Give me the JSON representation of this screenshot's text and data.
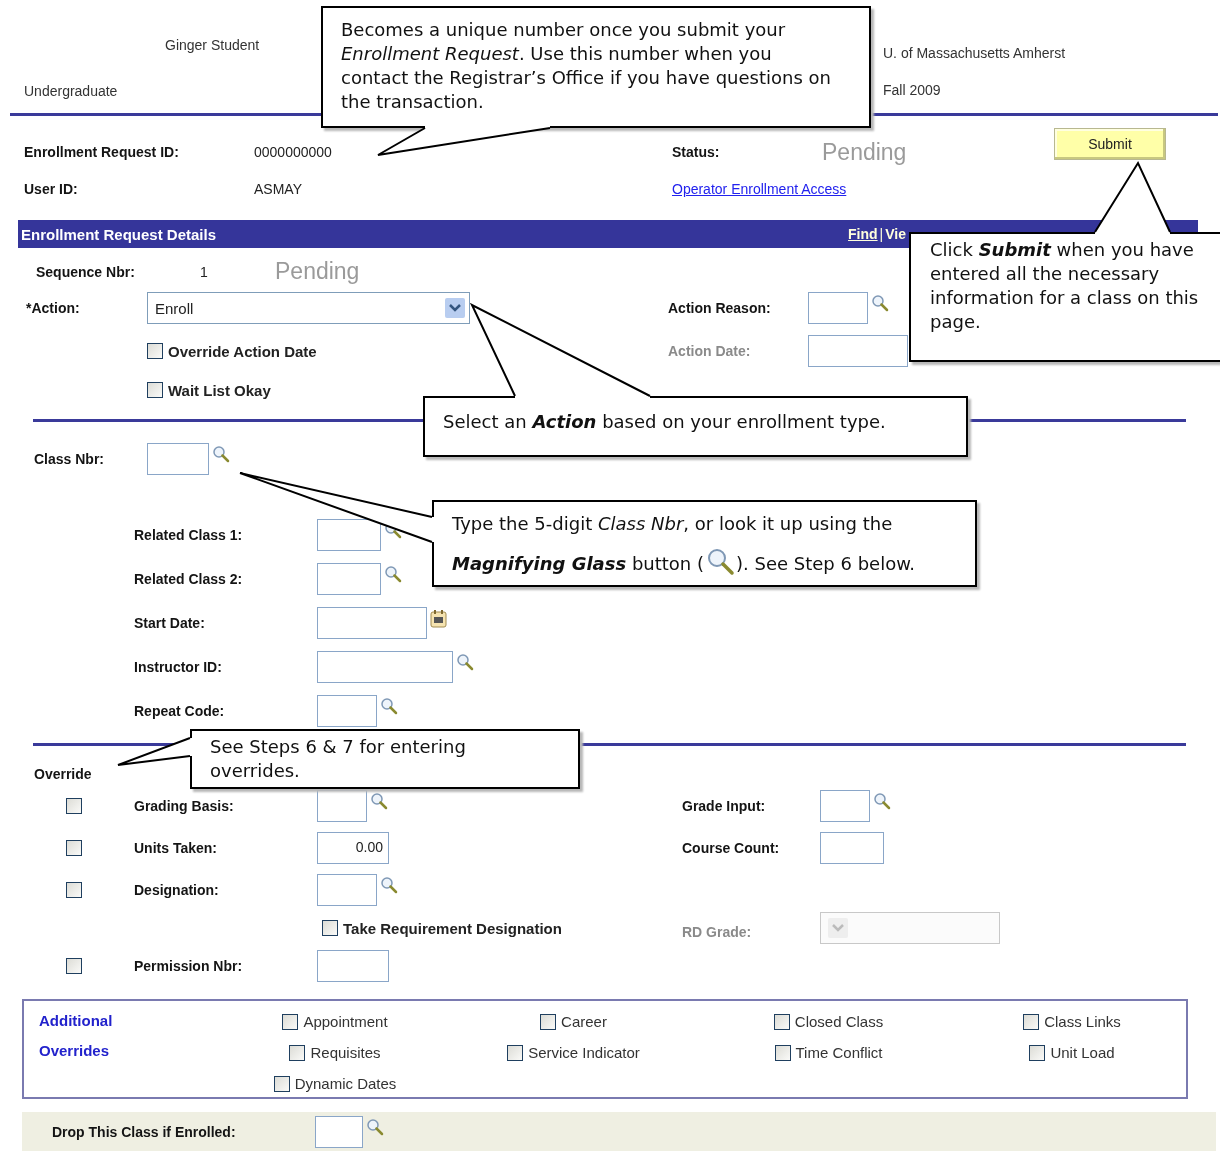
{
  "header": {
    "student_name": "Ginger Student",
    "career": "Undergraduate",
    "institution": "U. of Massachusetts Amherst",
    "term": "Fall 2009"
  },
  "request": {
    "id_label": "Enrollment Request ID:",
    "id_value": "0000000000",
    "user_label": "User ID:",
    "user_value": "ASMAY",
    "status_label": "Status:",
    "status_value": "Pending",
    "operator_link": "Operator Enrollment Access",
    "submit_button": "Submit"
  },
  "details": {
    "title": "Enrollment Request Details",
    "find_link": "Find",
    "separator": "|",
    "view_link": "Vie",
    "sequence_label": "Sequence Nbr:",
    "sequence_value": "1",
    "sequence_status": "Pending",
    "action": {
      "label": "*Action:",
      "value": "Enroll"
    },
    "action_reason": {
      "label": "Action Reason:"
    },
    "action_date": {
      "label": "Action Date:",
      "disabled": true
    },
    "options": [
      {
        "label": "Override Action Date",
        "checked": false
      },
      {
        "label": "Wait List Okay",
        "checked": false
      }
    ],
    "class_nbr": {
      "label": "Class Nbr:"
    },
    "class_fields": [
      {
        "label": "Related Class 1:",
        "kind": "lookup"
      },
      {
        "label": "Related Class 2:",
        "kind": "lookup"
      },
      {
        "label": "Start Date:",
        "kind": "date"
      },
      {
        "label": "Instructor ID:",
        "kind": "lookup"
      },
      {
        "label": "Repeat Code:",
        "kind": "lookup"
      }
    ]
  },
  "override": {
    "label": "Override",
    "rows": [
      {
        "label": "Grading Basis:",
        "checked": false,
        "kind": "lookup"
      },
      {
        "label": "Units Taken:",
        "checked": false,
        "kind": "text",
        "value": "0.00"
      },
      {
        "label": "Designation:",
        "checked": false,
        "kind": "lookup"
      },
      {
        "label": "Permission Nbr:",
        "checked": false,
        "kind": "text"
      }
    ],
    "take_requirement": {
      "label": "Take Requirement Designation",
      "checked": false
    },
    "grade_input": {
      "label": "Grade Input:"
    },
    "course_count": {
      "label": "Course Count:"
    },
    "rd_grade": {
      "label": "RD Grade:",
      "disabled": true
    }
  },
  "additional_overrides": {
    "label": "Additional Overrides",
    "columns": [
      [
        {
          "label": "Appointment",
          "checked": false
        },
        {
          "label": "Requisites",
          "checked": false
        },
        {
          "label": "Dynamic Dates",
          "checked": false
        }
      ],
      [
        {
          "label": "Career",
          "checked": false
        },
        {
          "label": "Service Indicator",
          "checked": false
        }
      ],
      [
        {
          "label": "Closed Class",
          "checked": false
        },
        {
          "label": "Time Conflict",
          "checked": false
        }
      ],
      [
        {
          "label": "Class Links",
          "checked": false
        },
        {
          "label": "Unit Load",
          "checked": false
        }
      ]
    ]
  },
  "drop": {
    "label": "Drop This Class if Enrolled:"
  },
  "callouts": [
    {
      "text": "Becomes a unique number once you submit your *Enrollment Request*. Use this number when you contact the Registrar’s Office if you have questions on the transaction."
    },
    {
      "text": "Click **Submit** when you have entered all the necessary information for a class on this page."
    },
    {
      "text": "Select an **Action** based on your enrollment type."
    },
    {
      "text": "Type the 5-digit *Class Nbr*, or look it up using the",
      "text_2": "**Magnifying Glass** button (",
      "text_after": "). See Step 6 below."
    },
    {
      "text": "See Steps 6 & 7 for entering overrides."
    }
  ]
}
